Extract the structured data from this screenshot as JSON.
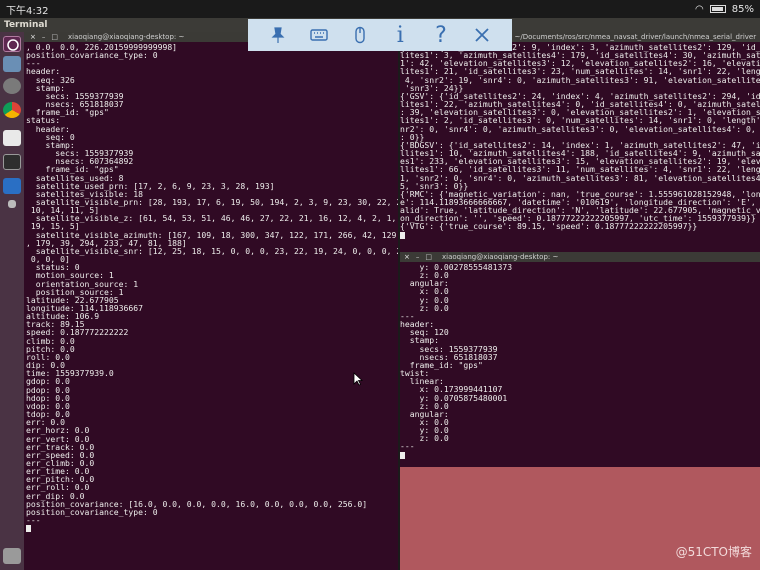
{
  "statusbar": {
    "time": "下午4:32",
    "battery": "85%"
  },
  "topbar": {
    "title": "Terminal"
  },
  "left_terminal": {
    "title": "xiaoqiang@xiaoqiang-desktop: ~",
    "lines": [
      ", 0.0, 0.0, 226.20159999999998]",
      "position_covariance_type: 0",
      "---",
      "header:",
      "  seq: 326",
      "  stamp:",
      "    secs: 1559377939",
      "    nsecs: 651818037",
      "  frame_id: \"gps\"",
      "status:",
      "  header:",
      "    seq: 0",
      "    stamp:",
      "      secs: 1559377939",
      "      nsecs: 607364892",
      "    frame_id: \"gps\"",
      "  satellites_used: 8",
      "  satellite_used_prn: [17, 2, 6, 9, 23, 3, 28, 193]",
      "  satellites_visible: 18",
      "  satellite_visible_prn: [28, 193, 17, 6, 19, 50, 194, 2, 3, 9, 23, 30, 22, 24,",
      " 10, 14, 11, 5]",
      "  satellite_visible_z: [61, 54, 53, 51, 46, 46, 27, 22, 21, 16, 12, 4, 2, 1, 66,",
      " 19, 15, 5]",
      "  satellite_visible_azimuth: [167, 109, 18, 300, 347, 122, 171, 266, 42, 129, 91",
      ", 179, 39, 294, 233, 47, 81, 188]",
      "  satellite_visible_snr: [12, 25, 18, 15, 0, 0, 0, 23, 22, 19, 24, 0, 0, 0, 22,",
      " 0, 0, 0]",
      "  status: 0",
      "  motion_source: 1",
      "  orientation_source: 1",
      "  position_source: 1",
      "latitude: 22.677905",
      "longitude: 114.118936667",
      "altitude: 106.9",
      "track: 89.15",
      "speed: 0.187772222222",
      "climb: 0.0",
      "pitch: 0.0",
      "roll: 0.0",
      "dip: 0.0",
      "time: 1559377939.0",
      "gdop: 0.0",
      "pdop: 0.0",
      "hdop: 0.0",
      "vdop: 0.0",
      "tdop: 0.0",
      "err: 0.0",
      "err_horz: 0.0",
      "err_vert: 0.0",
      "err_track: 0.0",
      "err_speed: 0.0",
      "err_climb: 0.0",
      "err_time: 0.0",
      "err_pitch: 0.0",
      "err_roll: 0.0",
      "err_dip: 0.0",
      "position_covariance: [16.0, 0.0, 0.0, 0.0, 16.0, 0.0, 0.0, 0.0, 256.0]",
      "position_covariance_type: 0",
      "---"
    ]
  },
  "right_top_terminal": {
    "title": "xiaoqiang@xiaoqiang-desktop: ~/Documents/ros/src/nmea_navsat_driver/launch/nmea_serial_driver",
    "lines": [
      "{'GSV': {'id_satellites2': 9, 'index': 3, 'azimuth_satellites2': 129, 'id_sat",
      "lites1': 3, 'azimuth_satellites4': 179, 'id_satellites4': 30, 'azimuth_satellite",
      "1': 42, 'elevation_satellites3': 12, 'elevation_satellites2': 16, 'elevation_s",
      "lites1': 21, 'id_satellites3': 23, 'num_satellites': 14, 'snr1': 22, 'length'",
      " 4, 'snr2': 19, 'snr4': 0, 'azimuth_satellites3': 91, 'elevation_satellites4':",
      " 'snr3': 24}}",
      "{'GSV': {'id_satellites2': 24, 'index': 4, 'azimuth_satellites2': 294, 'id_sat",
      "lites1': 22, 'azimuth_satellites4': 0, 'id_satellites4': 0, 'azimuth_satellites",
      ": 39, 'elevation_satellites3': 0, 'elevation_satellites2': 1, 'elevation_sat",
      "lites1': 2, 'id_satellites3': 0, 'num_satellites': 14, 'snr1': 0, 'length': 4,",
      "nr2': 0, 'snr4': 0, 'azimuth_satellites3': 0, 'elevation_satellites4': 0, 'snr3'",
      ": 0}}",
      "{'BDGSV': {'id_satellites2': 14, 'index': 1, 'azimuth_satellites2': 47, 'id_sat",
      "llites1': 10, 'azimuth_satellites4': 188, 'id_satellites4': 9, 'azimuth_satellit",
      "es1': 233, 'elevation_satellites3': 15, 'elevation_satellites2': 19, 'elevation",
      "llites1': 66, 'id_satellites3': 11, 'num_satellites': 4, 'snr1': 22, 'length':",
      "1, 'snr2': 0, 'snr4': 0, 'azimuth_satellites3': 81, 'elevation_satellites4': 5",
      "5, 'snr3': 0}}",
      "{'RMC': {'magnetic_variation': nan, 'true_course': 1.555961028152948, 'longitu",
      "e': 114.11893666666667, 'datetime': '010619', 'longitude_direction': 'E', 'fix_",
      "alid': True, 'latitude_direction': 'N', 'latitude': 22.677905, 'magnetic_varia",
      "on_direction': '', 'speed': 0.18777222222205997, 'utc_time': 1559377939}}",
      "{'VTG': {'true_course': 89.15, 'speed': 0.18777222222205997}}"
    ]
  },
  "right_bottom_terminal": {
    "title": "xiaoqiang@xiaoqiang-desktop: ~",
    "lines": [
      "    y: 0.00278555481373",
      "    z: 0.0",
      "  angular:",
      "    x: 0.0",
      "    y: 0.0",
      "    z: 0.0",
      "---",
      "header:",
      "  seq: 120",
      "  stamp:",
      "    secs: 1559377939",
      "    nsecs: 651818037",
      "  frame_id: \"gps\"",
      "twist:",
      "  linear:",
      "    x: 0.173999441107",
      "    y: 0.0705875480001",
      "    z: 0.0",
      "  angular:",
      "    x: 0.0",
      "    y: 0.0",
      "    z: 0.0",
      "---"
    ]
  },
  "watermark": "@51CTO博客",
  "toolbar": {
    "icons": [
      "pin-icon",
      "keyboard-icon",
      "mouse-icon",
      "info-icon",
      "help-icon",
      "close-icon"
    ],
    "info_glyph": "i",
    "help_glyph": "?",
    "color": "#3a6fb0"
  }
}
